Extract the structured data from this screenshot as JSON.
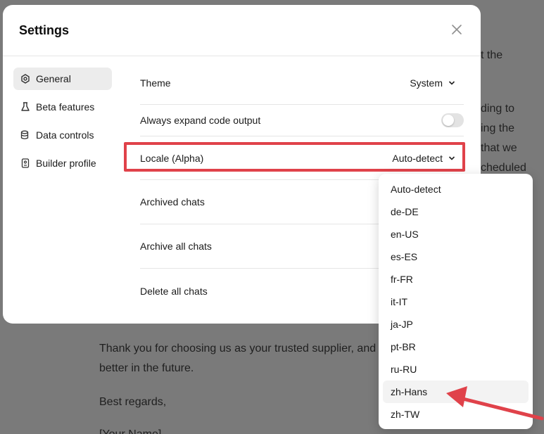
{
  "background": {
    "line1": "Thank you for choosing us as your trusted supplier, and w",
    "line2": "better in the future.",
    "line3": "Best regards,",
    "line4": "[Your Name]",
    "frag1": "t the",
    "frag2": "ding to",
    "frag3": "ing the",
    "frag4": "that we",
    "frag5": "cheduled"
  },
  "modal": {
    "title": "Settings"
  },
  "sidebar": {
    "items": [
      {
        "label": "General",
        "icon": "gear-icon"
      },
      {
        "label": "Beta features",
        "icon": "flask-icon"
      },
      {
        "label": "Data controls",
        "icon": "database-icon"
      },
      {
        "label": "Builder profile",
        "icon": "id-badge-icon"
      }
    ]
  },
  "settings": {
    "theme_label": "Theme",
    "theme_value": "System",
    "code_output_label": "Always expand code output",
    "code_output_enabled": false,
    "locale_label": "Locale (Alpha)",
    "locale_value": "Auto-detect",
    "archived_label": "Archived chats",
    "archive_all_label": "Archive all chats",
    "delete_all_label": "Delete all chats"
  },
  "locale_options": [
    "Auto-detect",
    "de-DE",
    "en-US",
    "es-ES",
    "fr-FR",
    "it-IT",
    "ja-JP",
    "pt-BR",
    "ru-RU",
    "zh-Hans",
    "zh-TW"
  ],
  "colors": {
    "highlight": "#e0424a",
    "overlay": "#7a7a7a"
  }
}
